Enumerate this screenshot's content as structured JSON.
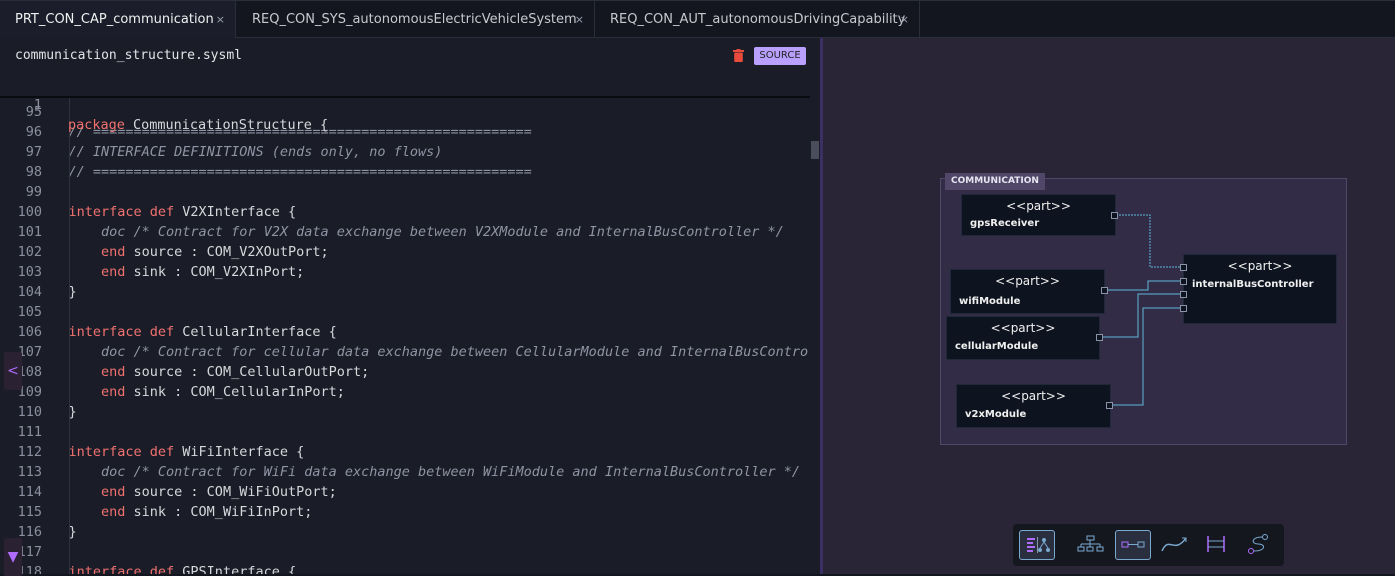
{
  "tabs": [
    {
      "label": "PRT_CON_CAP_communication",
      "active": true
    },
    {
      "label": "REQ_CON_SYS_autonomousElectricVehicleSystem",
      "active": false
    },
    {
      "label": "REQ_CON_AUT_autonomousDrivingCapability",
      "active": false
    }
  ],
  "tab_close": "×",
  "editor": {
    "file_name": "communication_structure.sysml",
    "source_label": "SOURCE",
    "sticky": {
      "num": "1",
      "kw": "package",
      "rest": " CommunicationStructure {"
    },
    "lines": [
      {
        "num": "95",
        "parts": []
      },
      {
        "num": "96",
        "parts": [
          {
            "t": "cm",
            "v": "    // ======================================================"
          }
        ]
      },
      {
        "num": "97",
        "parts": [
          {
            "t": "cm",
            "v": "    // INTERFACE DEFINITIONS (ends only, no flows)"
          }
        ]
      },
      {
        "num": "98",
        "parts": [
          {
            "t": "cm",
            "v": "    // ======================================================"
          }
        ]
      },
      {
        "num": "99",
        "parts": []
      },
      {
        "num": "100",
        "parts": [
          {
            "t": "kw",
            "v": "    interface def"
          },
          {
            "t": "tx",
            "v": " V2XInterface {"
          }
        ]
      },
      {
        "num": "101",
        "parts": [
          {
            "t": "cm",
            "v": "        doc /* Contract for V2X data exchange between V2XModule and InternalBusController */"
          }
        ]
      },
      {
        "num": "102",
        "parts": [
          {
            "t": "kw",
            "v": "        end"
          },
          {
            "t": "tx",
            "v": " source : COM_V2XOutPort;"
          }
        ]
      },
      {
        "num": "103",
        "parts": [
          {
            "t": "kw",
            "v": "        end"
          },
          {
            "t": "tx",
            "v": " sink : COM_V2XInPort;"
          }
        ]
      },
      {
        "num": "104",
        "parts": [
          {
            "t": "tx",
            "v": "    }"
          }
        ]
      },
      {
        "num": "105",
        "parts": []
      },
      {
        "num": "106",
        "parts": [
          {
            "t": "kw",
            "v": "    interface def"
          },
          {
            "t": "tx",
            "v": " CellularInterface {"
          }
        ]
      },
      {
        "num": "107",
        "parts": [
          {
            "t": "cm",
            "v": "        doc /* Contract for cellular data exchange between CellularModule and InternalBusControl"
          }
        ]
      },
      {
        "num": "108",
        "parts": [
          {
            "t": "kw",
            "v": "        end"
          },
          {
            "t": "tx",
            "v": " source : COM_CellularOutPort;"
          }
        ]
      },
      {
        "num": "109",
        "parts": [
          {
            "t": "kw",
            "v": "        end"
          },
          {
            "t": "tx",
            "v": " sink : COM_CellularInPort;"
          }
        ]
      },
      {
        "num": "110",
        "parts": [
          {
            "t": "tx",
            "v": "    }"
          }
        ]
      },
      {
        "num": "111",
        "parts": []
      },
      {
        "num": "112",
        "parts": [
          {
            "t": "kw",
            "v": "    interface def"
          },
          {
            "t": "tx",
            "v": " WiFiInterface {"
          }
        ]
      },
      {
        "num": "113",
        "parts": [
          {
            "t": "cm",
            "v": "        doc /* Contract for WiFi data exchange between WiFiModule and InternalBusController */"
          }
        ]
      },
      {
        "num": "114",
        "parts": [
          {
            "t": "kw",
            "v": "        end"
          },
          {
            "t": "tx",
            "v": " source : COM_WiFiOutPort;"
          }
        ]
      },
      {
        "num": "115",
        "parts": [
          {
            "t": "kw",
            "v": "        end"
          },
          {
            "t": "tx",
            "v": " sink : COM_WiFiInPort;"
          }
        ]
      },
      {
        "num": "116",
        "parts": [
          {
            "t": "tx",
            "v": "    }"
          }
        ]
      },
      {
        "num": "117",
        "parts": []
      },
      {
        "num": "118",
        "parts": [
          {
            "t": "kw",
            "v": "    interface def"
          },
          {
            "t": "tx",
            "v": " GPSInterface {"
          }
        ]
      }
    ]
  },
  "side_buttons": {
    "collapse": "<",
    "expand": "▼"
  },
  "diagram": {
    "package_label": "COMMUNICATION",
    "stereotype": "<<part>>",
    "parts": [
      {
        "id": "gps",
        "name": "gpsReceiver"
      },
      {
        "id": "wifi",
        "name": "wifiModule"
      },
      {
        "id": "cell",
        "name": "cellularModule"
      },
      {
        "id": "v2x",
        "name": "v2xModule"
      },
      {
        "id": "ibc",
        "name": "internalBusController"
      }
    ]
  },
  "toolbar_icons": [
    "split-view-icon",
    "tree-layout-icon",
    "connection-icon",
    "curve-icon",
    "sequence-icon",
    "flow-icon"
  ],
  "colors": {
    "keyword": "#f0716f",
    "comment": "#8f93a3",
    "accent": "#b9a0ff",
    "connector": "#5fb8d8"
  }
}
